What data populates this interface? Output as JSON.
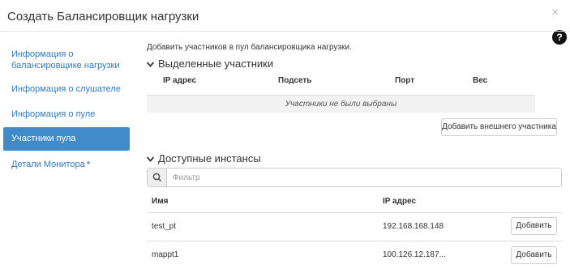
{
  "modal": {
    "title": "Создать Балансировщик нагрузки",
    "close_glyph": "×",
    "help_glyph": "?"
  },
  "nav": {
    "items": [
      {
        "label": "Информация о балансировщике нагрузки"
      },
      {
        "label": "Информация о слушателе"
      },
      {
        "label": "Информация о пуле"
      },
      {
        "label": "Участники пула",
        "active": true
      },
      {
        "label": "Детали Монитора",
        "required_mark": "*"
      }
    ]
  },
  "content": {
    "description": "Добавить участников в пул балансировщика нагрузки.",
    "selected": {
      "heading": "Выделенные участники",
      "columns": [
        "IP адрес",
        "Подсеть",
        "Порт",
        "Вес"
      ],
      "empty_text": "Участники не были выбраны",
      "add_external_label": "Добавить внешнего участника"
    },
    "available": {
      "heading": "Доступные инстансы",
      "filter_placeholder": "Фильтр",
      "columns": [
        "Имя",
        "IP адрес"
      ],
      "rows": [
        {
          "name": "test_pt",
          "ip": "192.168.168.148",
          "action": "Добавить"
        },
        {
          "name": "mappt1",
          "ip": "100.126.12.187...",
          "action": "Добавить"
        }
      ]
    }
  },
  "colors": {
    "accent": "#428bca",
    "link": "#337ab7",
    "empty_row_bg": "#f2f2f2"
  },
  "icons": {
    "collapse": "chevron-down-icon",
    "filter": "search-icon",
    "help": "question-circle-icon",
    "close": "close-icon"
  }
}
